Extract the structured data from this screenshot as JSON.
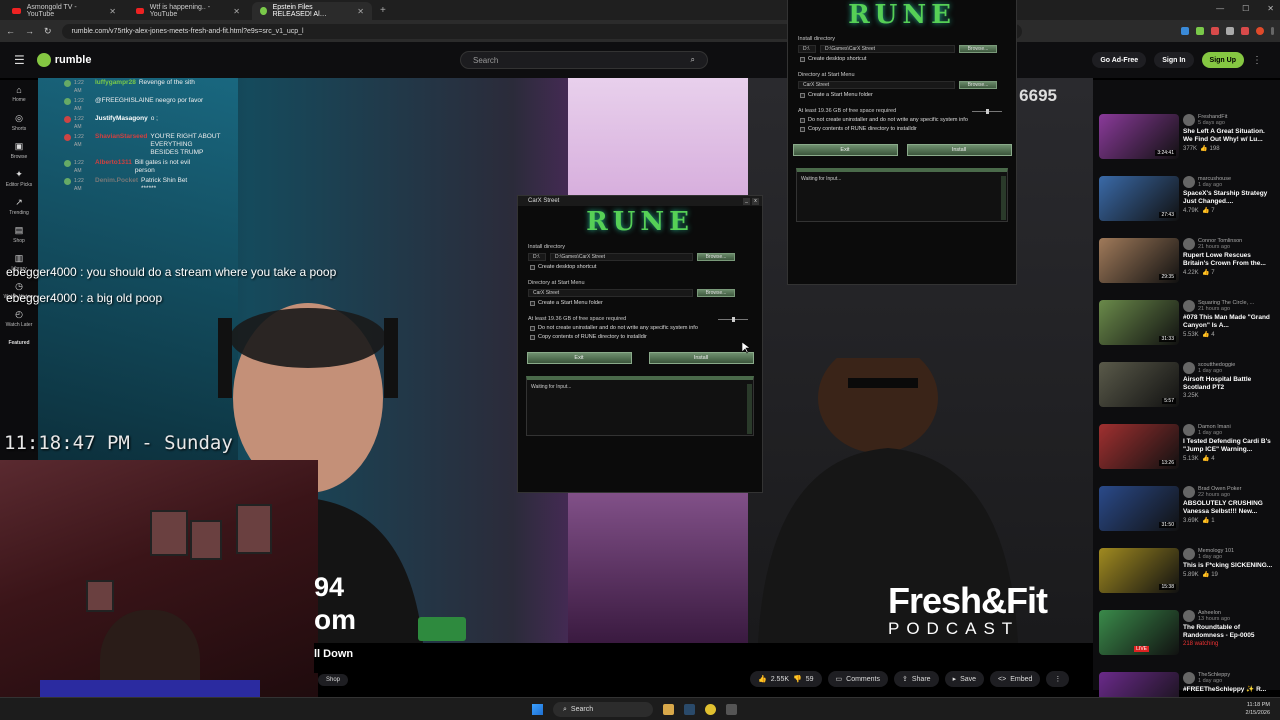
{
  "browser": {
    "tabs": [
      {
        "label": "Asmongold TV - YouTube",
        "icon": "youtube-icon",
        "active": false
      },
      {
        "label": "Wtf is happening.. - YouTube",
        "icon": "youtube-icon",
        "active": false
      },
      {
        "label": "Epstein Files RELEASED! Al…",
        "icon": "rumble-icon",
        "active": true
      }
    ],
    "url": "rumble.com/v75rtky-alex-jones-meets-fresh-and-fit.html?e9s=src_v1_ucp_l"
  },
  "header": {
    "logo_text": "rumble",
    "search_placeholder": "Search",
    "go_ad_free": "Go Ad-Free",
    "sign_in": "Sign In",
    "sign_up": "Sign Up"
  },
  "sidebar": {
    "items": [
      {
        "label": "Home",
        "icon": "home-icon"
      },
      {
        "label": "Shorts",
        "icon": "shorts-icon"
      },
      {
        "label": "Browse",
        "icon": "browse-icon"
      },
      {
        "label": "Editor Picks",
        "icon": "editor-picks-icon"
      },
      {
        "label": "Trending",
        "icon": "trending-icon"
      },
      {
        "label": "Shop",
        "icon": "shop-icon"
      },
      {
        "label": "Library",
        "icon": "library-icon"
      },
      {
        "label": "Watch History",
        "icon": "history-icon"
      },
      {
        "label": "Watch Later",
        "icon": "watch-later-icon"
      }
    ],
    "featured": "Featured"
  },
  "chat": {
    "messages": [
      {
        "time": "1:22 AM",
        "name": "luffygampr28",
        "name_color": "#7ac94a",
        "text": "Revenge of the sith"
      },
      {
        "time": "1:22 AM",
        "name": "",
        "name_color": "#fff",
        "text": "@FREEGHISLAINE neegro por favor"
      },
      {
        "time": "1:22 AM",
        "name": "JustifyMasagony",
        "name_color": "#ffffff",
        "text": "o ;"
      },
      {
        "time": "1:22 AM",
        "name": "ShavianStarseed",
        "name_color": "#d04040",
        "text": "YOU'RE RIGHT ABOUT EVERYTHING BESIDES TRUMP"
      },
      {
        "time": "1:22 AM",
        "name": "Alberto1311",
        "name_color": "#d04040",
        "text": "Bill gates is not evil person"
      },
      {
        "time": "1:22 AM",
        "name": "Denim.Pocket",
        "name_color": "#777",
        "text": "Patrick Shin Bet ******"
      }
    ],
    "overlay": [
      {
        "name": "ebegger4000",
        "text": "you should do a stream where you take a poop"
      },
      {
        "name": "ebegger4000",
        "text": "a big old poop"
      }
    ]
  },
  "stream_clock": "11:18:47 PM - Sunday",
  "video": {
    "counter": "6695",
    "overlay_line1": "94",
    "overlay_line2": "om",
    "brand_line1": "Fresh&Fit",
    "brand_line2": "PODCAST",
    "title_fragment": "ll Down",
    "shop": "Shop"
  },
  "actions": {
    "likes": "2.55K",
    "dislikes": "59",
    "comments": "Comments",
    "share": "Share",
    "save": "Save",
    "embed": "Embed"
  },
  "installer": {
    "window_title": "CarX Street",
    "logo": "RUNE",
    "install_dir_label": "Install directory",
    "install_dir_value": "D:\\Games\\CarX Street",
    "drive": "D:\\",
    "browse": "Browse...",
    "desktop_shortcut": "Create desktop shortcut",
    "start_menu_label": "Directory at Start Menu",
    "start_menu_value": "CarX Street",
    "start_menu_folder": "Create a Start Menu folder",
    "space_required": "At least 19.36 GB of free space required",
    "no_uninstaller": "Do not create uninstaller and do not write any specific system info",
    "copy_contents": "Copy contents of RUNE directory to installdir",
    "exit": "Exit",
    "install": "Install",
    "log": "Waiting for Input..."
  },
  "recommended": [
    {
      "channel": "FreshandFit",
      "ago": "5 days ago",
      "title": "She Left A Great Situation. We Find Out Why! w/ Lu...",
      "views": "377K",
      "likes": "198",
      "duration": "3:24:41",
      "thumb": "#8a3a9a"
    },
    {
      "channel": "marcushouse",
      "ago": "1 day ago",
      "title": "SpaceX's Starship Strategy Just Changed....",
      "views": "4.79K",
      "likes": "7",
      "duration": "27:43",
      "thumb": "#3a6aa8"
    },
    {
      "channel": "Connor Tomlinson",
      "ago": "21 hours ago",
      "title": "Rupert Lowe Rescues Britain's Crown From the...",
      "views": "4.22K",
      "likes": "7",
      "duration": "29:35",
      "thumb": "#a07a5a"
    },
    {
      "channel": "Squaring The Circle, ...",
      "ago": "21 hours ago",
      "title": "#078 This Man Made \"Grand Canyon\" Is A...",
      "views": "5.53K",
      "likes": "4",
      "duration": "31:33",
      "thumb": "#6a8a4a"
    },
    {
      "channel": "scoutthedoggie",
      "ago": "1 day ago",
      "title": "Airsoft Hospital Battle Scotland PT2",
      "views": "3.25K",
      "likes": "",
      "duration": "5:57",
      "thumb": "#5a5a4a"
    },
    {
      "channel": "Damon Imani",
      "ago": "1 day ago",
      "title": "I Tested Defending Cardi B's \"Jump ICE\" Warning...",
      "views": "5.13K",
      "likes": "4",
      "duration": "13:26",
      "thumb": "#a03030"
    },
    {
      "channel": "Brad Owen Poker",
      "ago": "22 hours ago",
      "title": "ABSOLUTELY CRUSHING Vanessa Selbst!!! New...",
      "views": "3.69K",
      "likes": "1",
      "duration": "31:50",
      "thumb": "#2a4a8a"
    },
    {
      "channel": "Memology 101",
      "ago": "1 day ago",
      "title": "This is F*cking SICKENING...",
      "views": "5.89K",
      "likes": "19",
      "duration": "15:38",
      "thumb": "#a08a20"
    },
    {
      "channel": "Asheelon",
      "ago": "13 hours ago",
      "title": "The Roundtable of Randomness - Ep-0005",
      "views": "218 watching",
      "likes": "",
      "duration": "LIVE",
      "thumb": "#3a8a4a",
      "live": true
    },
    {
      "channel": "TheSchleppy",
      "ago": "1 day ago",
      "title": "#FREETheSchleppy ✨ R...",
      "views": "",
      "likes": "",
      "duration": "",
      "thumb": "#6a2a8a"
    }
  ],
  "taskbar": {
    "search": "Search",
    "time": "11:18 PM",
    "date": "2/15/2026"
  }
}
